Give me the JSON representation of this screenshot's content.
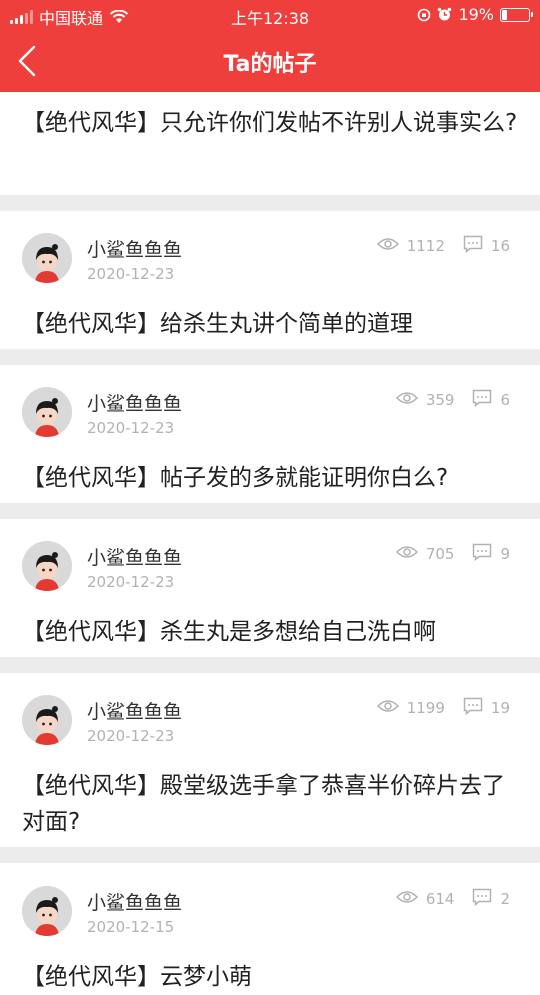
{
  "status_bar": {
    "carrier": "中国联通",
    "time": "上午12:38",
    "battery": "19%",
    "battery_level": 0.19
  },
  "header": {
    "title": "Ta的帖子"
  },
  "first_post": {
    "text": "【绝代风华】只允许你们发帖不许别人说事实么?"
  },
  "posts": [
    {
      "author": "小鲨鱼鱼鱼",
      "date": "2020-12-23",
      "views": "1112",
      "comments": "16",
      "text": "【绝代风华】给杀生丸讲个简单的道理"
    },
    {
      "author": "小鲨鱼鱼鱼",
      "date": "2020-12-23",
      "views": "359",
      "comments": "6",
      "text": "【绝代风华】帖子发的多就能证明你白么?"
    },
    {
      "author": "小鲨鱼鱼鱼",
      "date": "2020-12-23",
      "views": "705",
      "comments": "9",
      "text": "【绝代风华】杀生丸是多想给自己洗白啊"
    },
    {
      "author": "小鲨鱼鱼鱼",
      "date": "2020-12-23",
      "views": "1199",
      "comments": "19",
      "text": "【绝代风华】殿堂级选手拿了恭喜半价碎片去了对面?"
    },
    {
      "author": "小鲨鱼鱼鱼",
      "date": "2020-12-15",
      "views": "614",
      "comments": "2",
      "text": "【绝代风华】云梦小萌"
    }
  ],
  "icons": {
    "back": "chevron-left-icon",
    "views": "eye-icon",
    "comments": "comment-icon",
    "wifi": "wifi-icon",
    "alarm": "alarm-icon",
    "orientation_lock": "orientation-lock-icon"
  },
  "colors": {
    "brand_red": "#ee3f3c",
    "divider": "#ececec",
    "muted": "#b2b2b2"
  }
}
